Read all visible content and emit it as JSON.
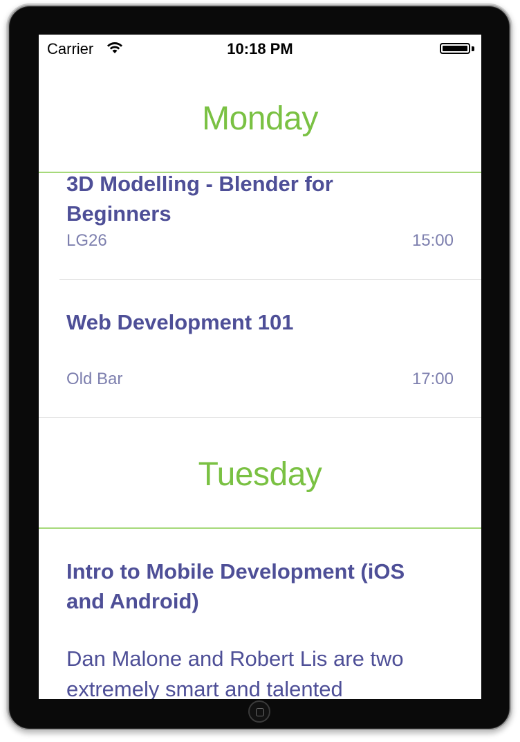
{
  "status_bar": {
    "carrier": "Carrier",
    "time": "10:18 PM",
    "wifi_icon": "wifi-icon",
    "battery_icon": "battery-icon",
    "battery_level": 1.0
  },
  "colors": {
    "day_header": "#7ac143",
    "divider_green": "#a6d97a",
    "event_title": "#4e4f97",
    "event_meta": "#7d7fae"
  },
  "sections": [
    {
      "day": "Monday",
      "events": [
        {
          "title": "3D Modelling - Blender for Beginners",
          "location": "LG26",
          "time": "15:00"
        },
        {
          "title": "Web Development 101",
          "location": "Old Bar",
          "time": "17:00"
        }
      ]
    },
    {
      "day": "Tuesday",
      "events": [
        {
          "title": "Intro to Mobile Development (iOS and Android)",
          "description": "Dan Malone and Robert Lis are two extremely smart and talented"
        }
      ]
    }
  ],
  "home_button_icon": "home-button-icon"
}
